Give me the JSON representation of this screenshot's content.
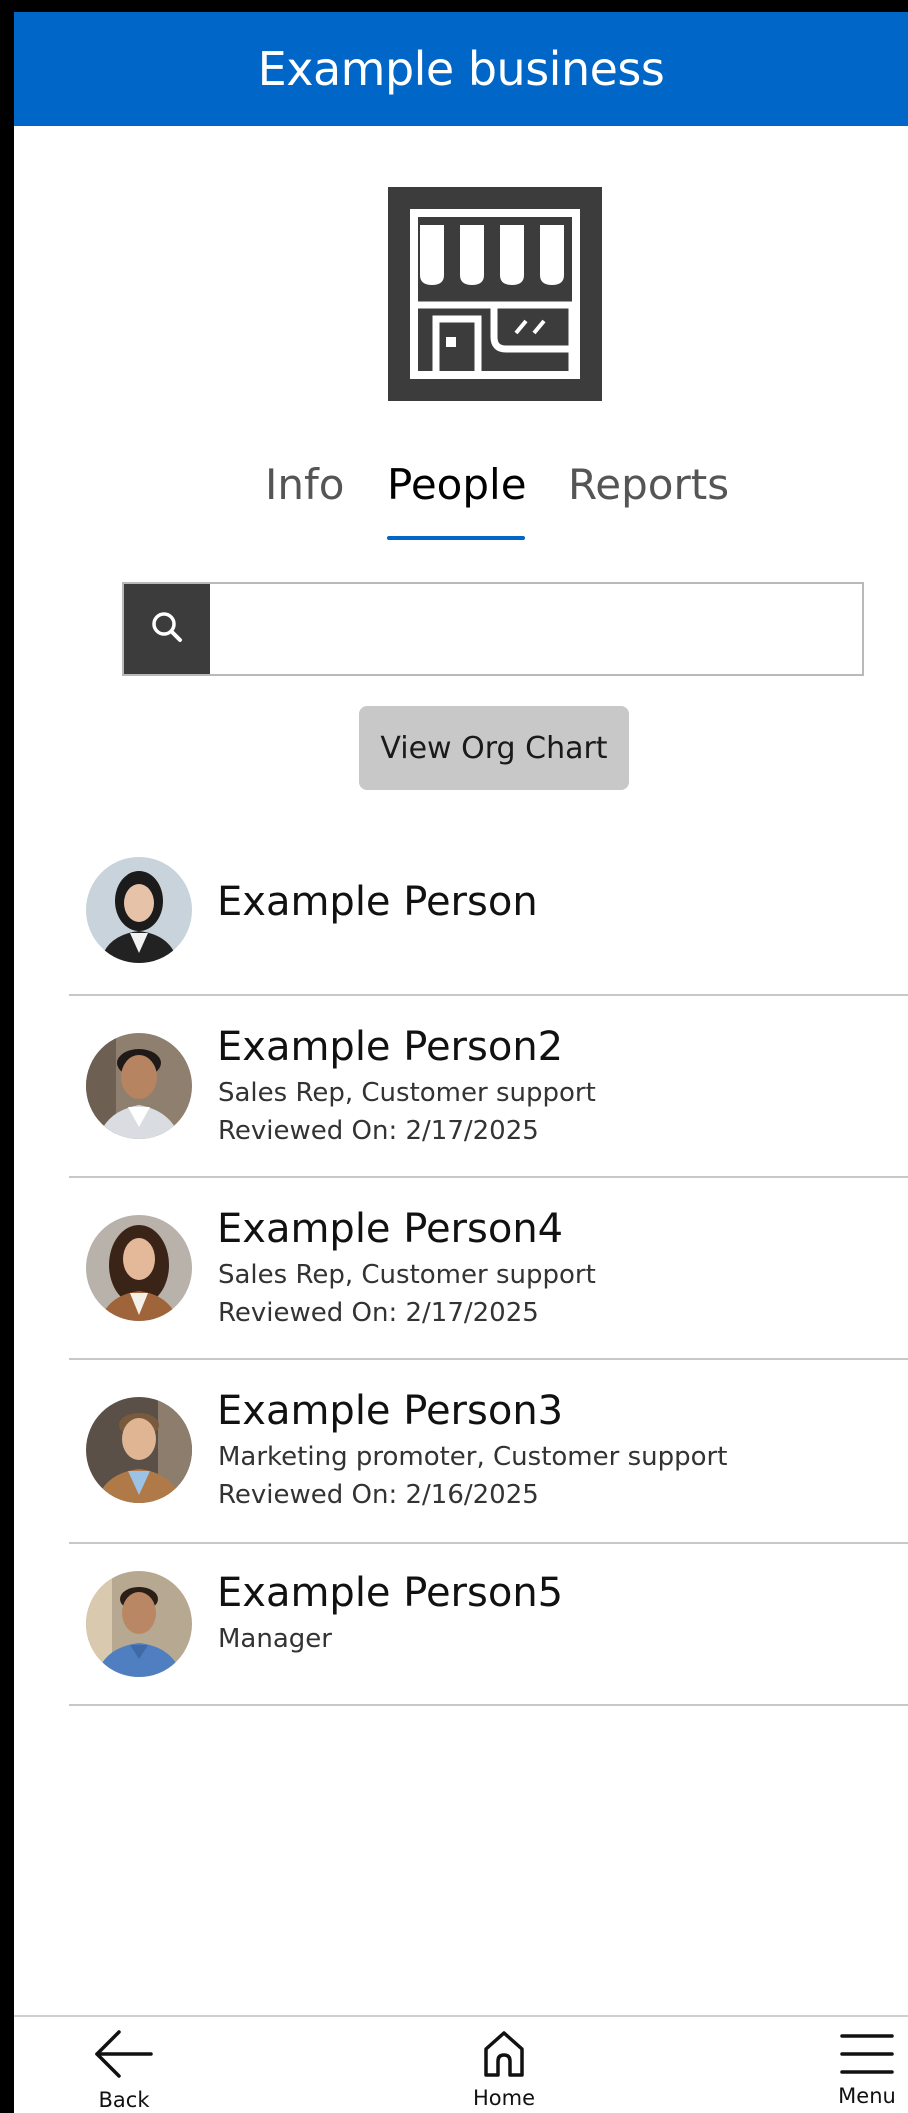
{
  "header": {
    "title": "Example business"
  },
  "logo": {
    "icon": "storefront-icon"
  },
  "tabs": [
    {
      "label": "Info",
      "active": false
    },
    {
      "label": "People",
      "active": true
    },
    {
      "label": "Reports",
      "active": false
    }
  ],
  "search": {
    "value": "",
    "placeholder": "",
    "icon": "search-icon"
  },
  "org_chart_button": {
    "label": "View Org Chart"
  },
  "people": [
    {
      "name": "Example Person",
      "role": "",
      "reviewed": ""
    },
    {
      "name": "Example Person2",
      "role": "Sales Rep, Customer support",
      "reviewed": "Reviewed On: 2/17/2025"
    },
    {
      "name": "Example Person4",
      "role": "Sales Rep, Customer support",
      "reviewed": "Reviewed On: 2/17/2025"
    },
    {
      "name": "Example Person3",
      "role": "Marketing promoter, Customer support",
      "reviewed": "Reviewed On: 2/16/2025"
    },
    {
      "name": "Example Person5",
      "role": "Manager",
      "reviewed": ""
    }
  ],
  "bottom_nav": [
    {
      "label": "Back",
      "icon": "back-arrow-icon"
    },
    {
      "label": "Home",
      "icon": "home-icon"
    },
    {
      "label": "Menu",
      "icon": "hamburger-menu-icon"
    }
  ],
  "colors": {
    "header_bg": "#0066c7",
    "tab_underline": "#0066c7",
    "logo_bg": "#3c3c3c",
    "button_bg": "#c8c8c8"
  }
}
